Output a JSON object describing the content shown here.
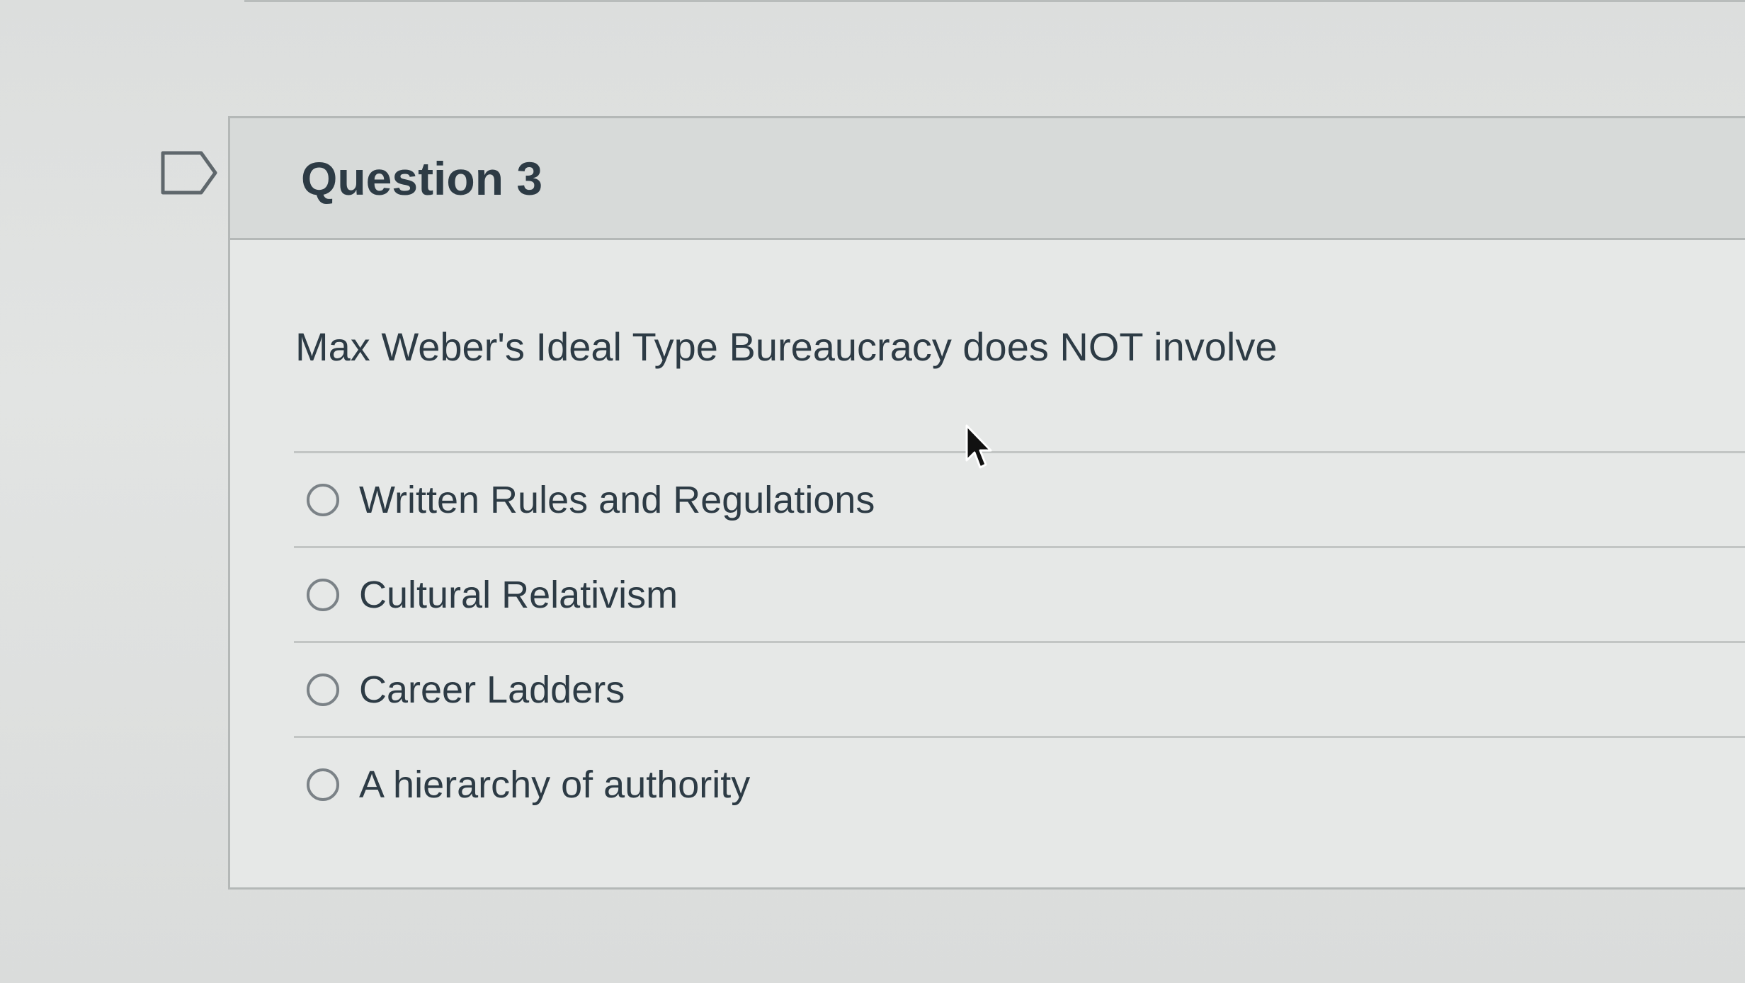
{
  "question": {
    "title": "Question 3",
    "prompt": "Max Weber's Ideal Type Bureaucracy does NOT involve",
    "answers": [
      {
        "label": "Written Rules and Regulations",
        "selected": false
      },
      {
        "label": "Cultural Relativism",
        "selected": false
      },
      {
        "label": "Career Ladders",
        "selected": false
      },
      {
        "label": "A hierarchy of authority",
        "selected": false
      }
    ]
  },
  "icons": {
    "flag": "flag-question-icon",
    "cursor": "mouse-pointer-icon"
  },
  "colors": {
    "text": "#2d3b45",
    "header_background": "#d7dad9",
    "card_background": "#e6e8e7",
    "border": "#b4b8b7",
    "radio_border": "#7b8287"
  }
}
